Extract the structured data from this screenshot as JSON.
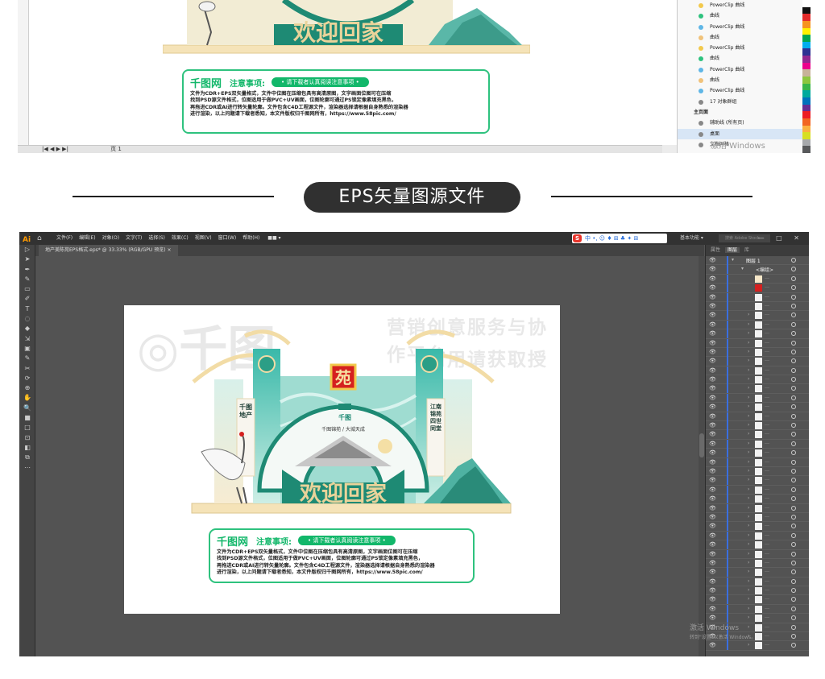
{
  "top_coreldraw": {
    "page_tab": "页 1",
    "objects": [
      {
        "label": "PowerClip 曲线",
        "color": "#f2c94c",
        "hdr": false
      },
      {
        "label": "曲线",
        "color": "#2ec27e",
        "hdr": false
      },
      {
        "label": "PowerClip 曲线",
        "color": "#5fb6e6",
        "hdr": false
      },
      {
        "label": "曲线",
        "color": "#f0c27a",
        "hdr": false
      },
      {
        "label": "PowerClip 曲线",
        "color": "#f2c94c",
        "hdr": false
      },
      {
        "label": "曲线",
        "color": "#2ec27e",
        "hdr": false
      },
      {
        "label": "PowerClip 曲线",
        "color": "#5fb6e6",
        "hdr": false
      },
      {
        "label": "曲线",
        "color": "#f0c27a",
        "hdr": false
      },
      {
        "label": "PowerClip 曲线",
        "color": "#5fb6e6",
        "hdr": false
      },
      {
        "label": "17 对象群组",
        "color": "#888888",
        "hdr": false
      },
      {
        "label": "主页面",
        "color": "",
        "hdr": true
      },
      {
        "label": "辅助线 (所有页)",
        "color": "#888888",
        "hdr": false
      },
      {
        "label": "桌面",
        "color": "#888888",
        "hdr": false
      },
      {
        "label": "文档网格",
        "color": "#888888",
        "hdr": false
      }
    ],
    "win_watermark": "激活 Windows",
    "palette": [
      "#ffffff",
      "#111111",
      "#e32b2b",
      "#f7941d",
      "#fff200",
      "#00a651",
      "#00aeef",
      "#2e3192",
      "#92278f",
      "#ec008c",
      "#c7b299",
      "#8dc63f",
      "#39b54a",
      "#00a99d",
      "#0072bc",
      "#662d91",
      "#ed1c24",
      "#f26522",
      "#fbb040",
      "#d7df23",
      "#a7a9ac",
      "#58595b"
    ]
  },
  "heading": "EPS矢量图源文件",
  "illustrator": {
    "logo": "Ai",
    "menus": [
      "文件(F)",
      "编辑(E)",
      "对象(O)",
      "文字(T)",
      "选择(S)",
      "效果(C)",
      "视图(V)",
      "窗口(W)",
      "帮助(H)",
      "  ■■ ▾"
    ],
    "ime": "中 •, ☺ ♦ ⊞ ♣ ✦ ⊞",
    "workspace": "基本功能 ▾",
    "search_placeholder": "搜索 Adobe Stock",
    "window_buttons": "— □ ✕",
    "doc_tab": "地产美陈苑EPS格式.eps* @ 33.33% (RGB/GPU 预览)  ×",
    "layers_tabs": [
      "属性",
      "图层",
      "库"
    ],
    "layer_top": "图层 1",
    "layer_group": "<编组>",
    "win_watermark": "激活 Windows",
    "win_watermark_sub": "转到\"设置\"以激活 Windows。"
  },
  "artwork": {
    "welcome": "欢迎回家",
    "seal": "苑",
    "left_banner": "千图地产",
    "right_banner": "江南锦苑 四世同堂",
    "center_logo": "千图",
    "center_slogan": "千图锦苑 / 大城天成",
    "watermark_brand": "千图",
    "watermark_line1": "营销创意服务与协作平台",
    "watermark_line2": "商用请获取授权"
  },
  "notice": {
    "logo": "千图网",
    "title": "注意事项:",
    "pill": "• 请下载者认真阅读注意事项 •",
    "lines": [
      "文件为CDR+EPS双矢量格式，文件中位图在压缩包具有高清原图，文字画面位图可在压缩",
      "找到PSD源文件格式，位图适用于做PVC+UV画面，位图轮廓可通过PS锁定像素填充黑色，",
      "再拖进CDR或AI进行转矢量轮廓。文件包含C4D工程源文件，渲染器选择请根据自身熟悉的渲染器",
      "进行渲染，以上问题请下载者悉知，本文件版权归千图网所有，https://www.58pic.com/"
    ]
  }
}
